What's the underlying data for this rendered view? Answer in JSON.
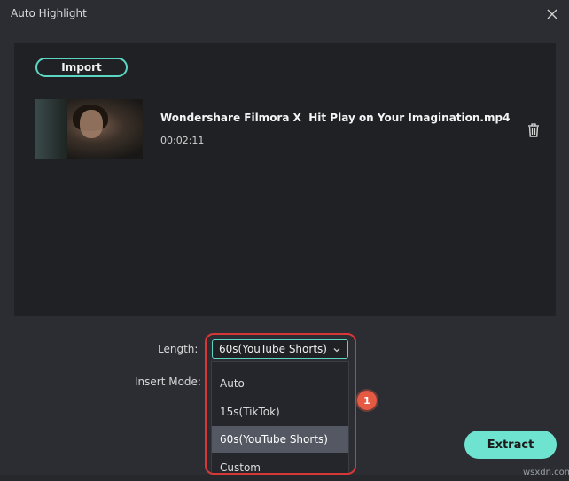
{
  "window": {
    "title": "Auto Highlight"
  },
  "panel": {
    "import_label": "Import",
    "file": {
      "name": "Wondershare Filmora X  Hit Play on Your Imagination.mp4",
      "duration": "00:02:11"
    }
  },
  "settings": {
    "length_label": "Length:",
    "insert_mode_label": "Insert Mode:",
    "length_selected": "60s(YouTube Shorts)",
    "length_options": [
      {
        "label": "Auto"
      },
      {
        "label": "15s(TikTok)"
      },
      {
        "label": "60s(YouTube Shorts)"
      },
      {
        "label": "Custom"
      }
    ]
  },
  "annotation": {
    "badge": "1",
    "color": "#d63838"
  },
  "actions": {
    "extract_label": "Extract"
  },
  "watermark": "wsxdn.com",
  "colors": {
    "accent": "#5cd6c2",
    "extract_bg": "#6ee3cf",
    "background": "#2b2d32",
    "panel": "#1f2125"
  }
}
